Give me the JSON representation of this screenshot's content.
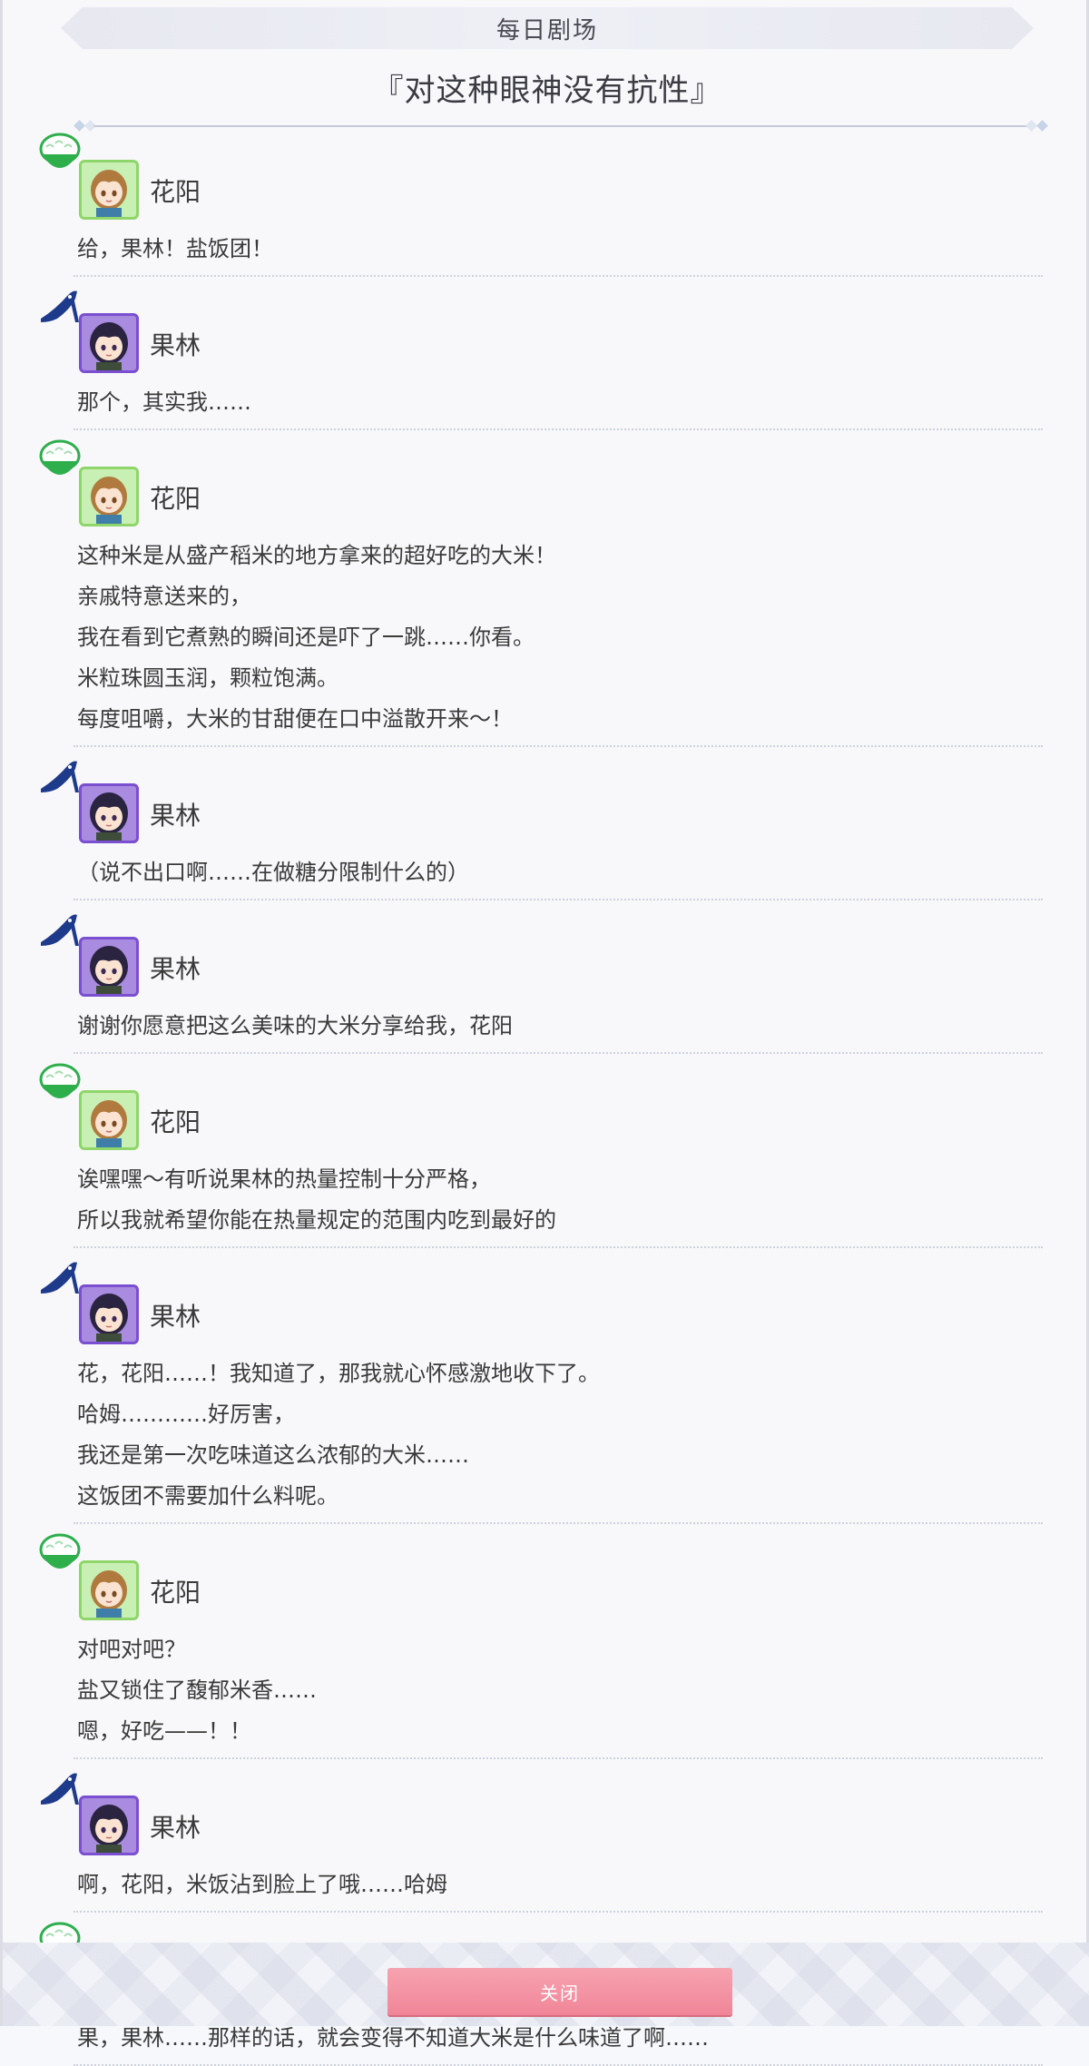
{
  "header": {
    "title": "每日剧场",
    "episode_title": "『对这种眼神没有抗性』"
  },
  "speakers": {
    "hanayo": {
      "name": "花阳",
      "icon": "rice-bowl-icon",
      "avatar_color": "#c9f0b4",
      "border_color": "#8fd66a"
    },
    "karin": {
      "name": "果林",
      "icon": "high-heel-icon",
      "avatar_color": "#a98be0",
      "border_color": "#7a4fd0"
    }
  },
  "dialogue": [
    {
      "speaker": "花阳",
      "lines": [
        "给，果林！盐饭团！"
      ]
    },
    {
      "speaker": "果林",
      "lines": [
        "那个，其实我……"
      ]
    },
    {
      "speaker": "花阳",
      "lines": [
        "这种米是从盛产稻米的地方拿来的超好吃的大米！",
        "亲戚特意送来的，",
        "我在看到它煮熟的瞬间还是吓了一跳……你看。",
        "米粒珠圆玉润，颗粒饱满。",
        "每度咀嚼，大米的甘甜便在口中溢散开来～！"
      ]
    },
    {
      "speaker": "果林",
      "lines": [
        "（说不出口啊……在做糖分限制什么的）"
      ]
    },
    {
      "speaker": "果林",
      "lines": [
        "谢谢你愿意把这么美味的大米分享给我，花阳"
      ]
    },
    {
      "speaker": "花阳",
      "lines": [
        "诶嘿嘿～有听说果林的热量控制十分严格，",
        "所以我就希望你能在热量规定的范围内吃到最好的"
      ]
    },
    {
      "speaker": "果林",
      "lines": [
        "花，花阳……！我知道了，那我就心怀感激地收下了。",
        "哈姆…………好厉害，",
        "我还是第一次吃味道这么浓郁的大米……",
        "这饭团不需要加什么料呢。"
      ]
    },
    {
      "speaker": "花阳",
      "lines": [
        "对吧对吧？",
        "盐又锁住了馥郁米香……",
        "嗯，好吃——！！"
      ]
    },
    {
      "speaker": "果林",
      "lines": [
        "啊，花阳，米饭沾到脸上了哦……哈姆"
      ]
    },
    {
      "speaker": "花阳",
      "lines": [
        "果，果林……那样的话，就会变得不知道大米是什么味道了啊……"
      ]
    }
  ],
  "footer": {
    "close_label": "关闭",
    "button_color": "#f08598"
  }
}
